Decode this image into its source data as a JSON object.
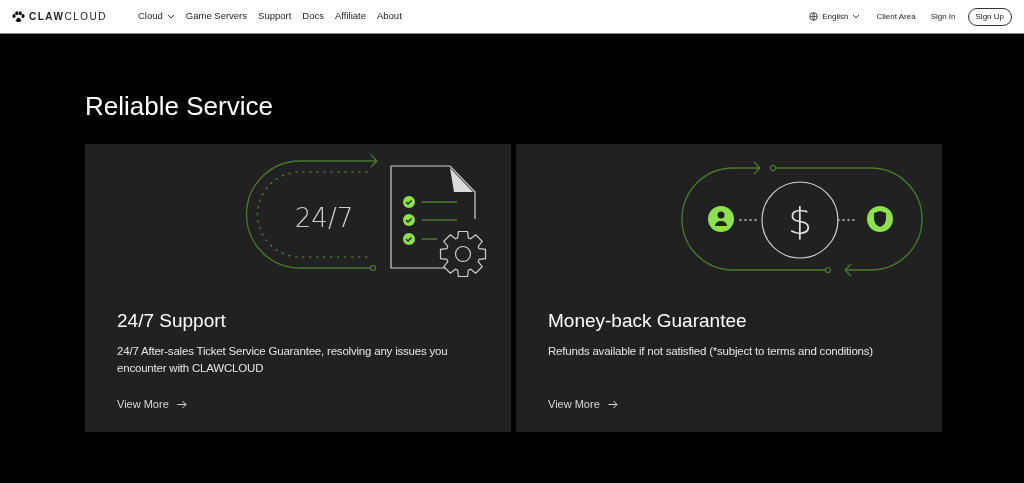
{
  "nav": {
    "logo": "**CLAW**CLOUD",
    "links": [
      {
        "label": "Cloud",
        "dropdown": true
      },
      {
        "label": "Game Servers",
        "dropdown": false
      },
      {
        "label": "Support",
        "dropdown": false
      },
      {
        "label": "Docs",
        "dropdown": false
      },
      {
        "label": "Affiliate",
        "dropdown": false
      },
      {
        "label": "About",
        "dropdown": false
      }
    ],
    "language": "English",
    "client_area": "Client Area",
    "sign_in": "Sign In",
    "sign_up": "Sign Up"
  },
  "section": {
    "title": "Reliable Service",
    "cards": [
      {
        "kind": "support",
        "badge": "24/7",
        "title": "24/7 Support",
        "text": "24/7 After-sales Ticket Service Guarantee, resolving any issues you encounter with CLAWCLOUD",
        "link": "View More"
      },
      {
        "kind": "money",
        "badge": "$",
        "title": "Money-back Guarantee",
        "text": "Refunds available if not satisfied (*subject to terms and conditions)",
        "link": "View More"
      }
    ]
  }
}
